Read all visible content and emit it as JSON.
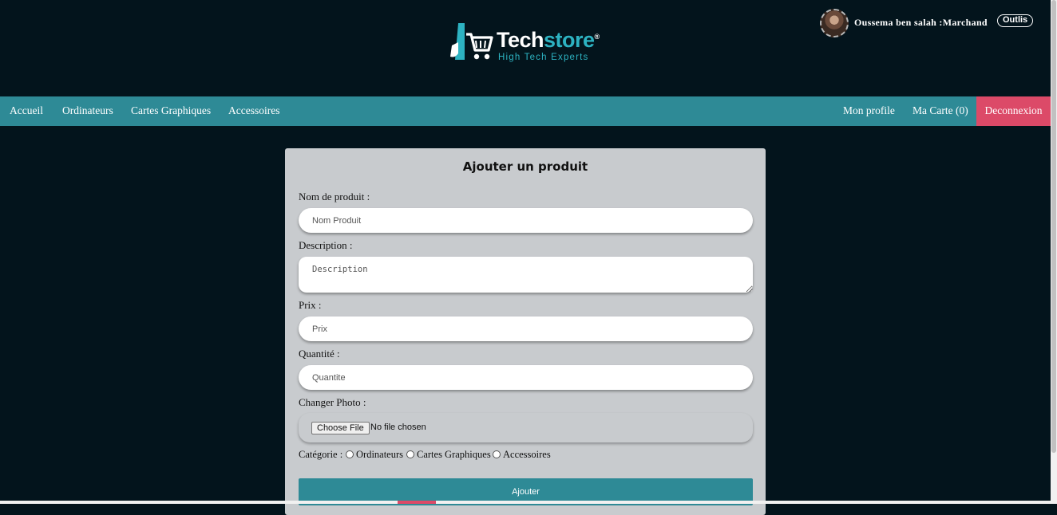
{
  "brand": {
    "name_part1": "Tech",
    "name_part2": "store",
    "registered": "®",
    "tagline": "High Tech Experts",
    "accent_color": "#2db3c2"
  },
  "user": {
    "display": "Oussema ben salah :Marchand",
    "tools_label": "Outlis"
  },
  "nav": {
    "items": [
      {
        "label": "Accueil"
      },
      {
        "label": "Ordinateurs"
      },
      {
        "label": "Cartes Graphiques"
      },
      {
        "label": "Accessoires"
      }
    ],
    "profile_label": "Mon profile",
    "cart_label": "Ma Carte (0)",
    "logout_label": "Deconnexion",
    "bar_color": "#2e8a96",
    "logout_color": "#dc4a68"
  },
  "form": {
    "title": "Ajouter un produit",
    "name_label": "Nom de produit :",
    "name_placeholder": "Nom Produit",
    "description_label": "Description :",
    "description_placeholder": "Description",
    "price_label": "Prix :",
    "price_placeholder": "Prix",
    "quantity_label": "Quantité :",
    "quantity_placeholder": "Quantite",
    "photo_label": "Changer Photo :",
    "file_button": "Choose File",
    "file_status": "No file chosen",
    "category_label": "Catégorie :",
    "categories": [
      "Ordinateurs",
      "Cartes Graphiques",
      "Accessoires"
    ],
    "submit_label": "Ajouter"
  }
}
